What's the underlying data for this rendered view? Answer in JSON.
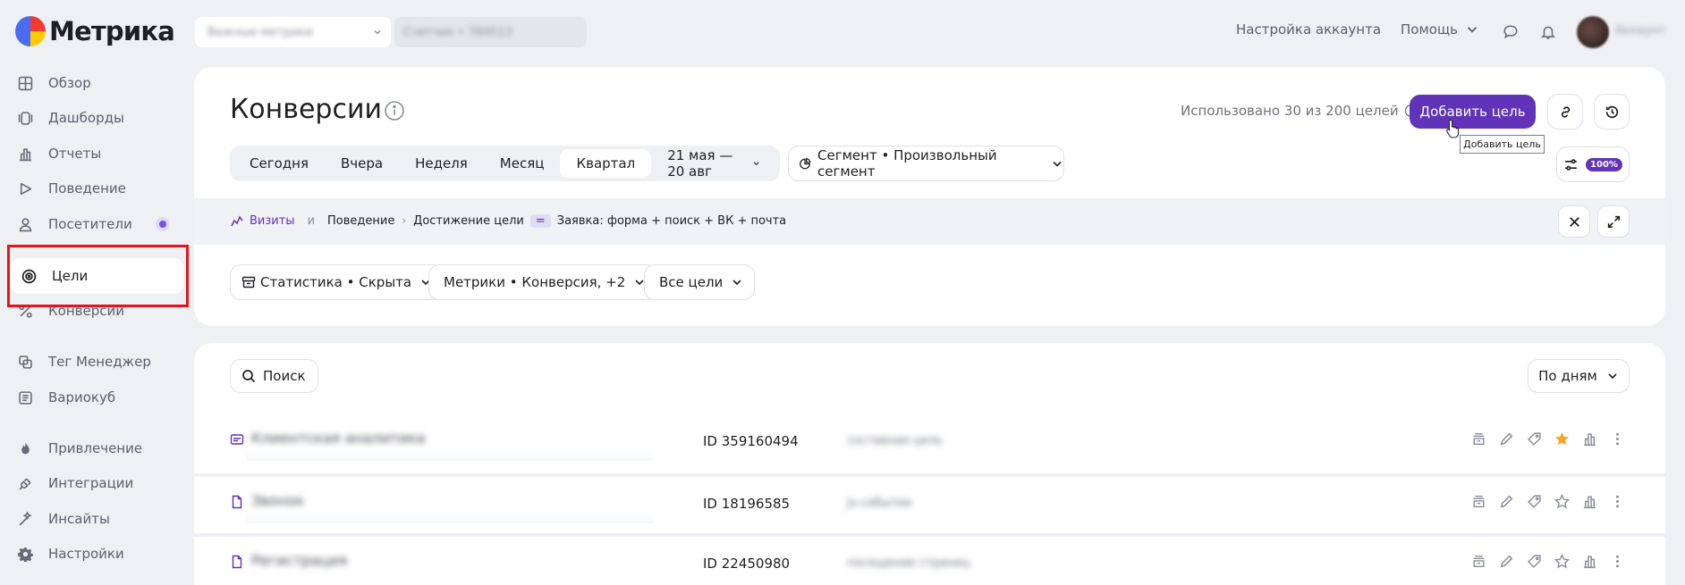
{
  "app": {
    "name": "Метрика"
  },
  "header": {
    "counter_name": "Важные метрики",
    "counter_path": "Счетчик • 784513",
    "account_settings": "Настройка аккаунта",
    "help": "Помощь",
    "user_name": "Аккаунт"
  },
  "sidebar": {
    "items": [
      {
        "label": "Обзор",
        "icon": "grid-icon"
      },
      {
        "label": "Дашборды",
        "icon": "dashboard-icon"
      },
      {
        "label": "Отчеты",
        "icon": "bar-chart-icon"
      },
      {
        "label": "Поведение",
        "icon": "play-icon"
      },
      {
        "label": "Посетители",
        "icon": "person-icon"
      },
      {
        "label": "Цели",
        "icon": "target-icon"
      },
      {
        "label": "Конверсии",
        "icon": "percent-icon"
      },
      {
        "label": "Тег Менеджер",
        "icon": "tag-manager-icon"
      },
      {
        "label": "Вариокуб",
        "icon": "variocube-icon"
      },
      {
        "label": "Привлечение",
        "icon": "flame-icon"
      },
      {
        "label": "Интеграции",
        "icon": "plug-icon"
      },
      {
        "label": "Инсайты",
        "icon": "wand-icon"
      },
      {
        "label": "Настройки",
        "icon": "gear-icon"
      }
    ]
  },
  "page": {
    "title": "Конверсии",
    "goals_used": "Использовано 30 из 200 целей",
    "add_goal": "Добавить цель",
    "add_goal_tooltip": "Добавить цель",
    "sampling": "100%",
    "periods": [
      "Сегодня",
      "Вчера",
      "Неделя",
      "Месяц",
      "Квартал"
    ],
    "selected_period": "Квартал",
    "date_range": "21 мая — 20 авг",
    "segment": "Сегмент • Произвольный сегмент"
  },
  "filter": {
    "visits": "Визиты",
    "and": "и",
    "crumb1": "Поведение",
    "crumb2": "Достижение цели",
    "eq": "=",
    "value": "Заявка: форма + поиск + ВК + почта"
  },
  "toolbar": {
    "stats": "Статистика • Скрыта",
    "metrics": "Метрики • Конверсия, +2",
    "goals": "Все цели"
  },
  "list": {
    "search_label": "Поиск",
    "group_label": "По дням",
    "rows": [
      {
        "name": "Клиентская аналитика",
        "id": "ID 359160494",
        "type": "составная цель",
        "starred": true
      },
      {
        "name": "Звонок",
        "id": "ID 18196585",
        "type": "js-событие",
        "starred": false
      },
      {
        "name": "Регистрация",
        "id": "ID 22450980",
        "type": "посещение страниц",
        "starred": false
      }
    ]
  },
  "colors": {
    "accent": "#6033b8",
    "highlight": "#e8141c",
    "star": "#f5a623"
  }
}
